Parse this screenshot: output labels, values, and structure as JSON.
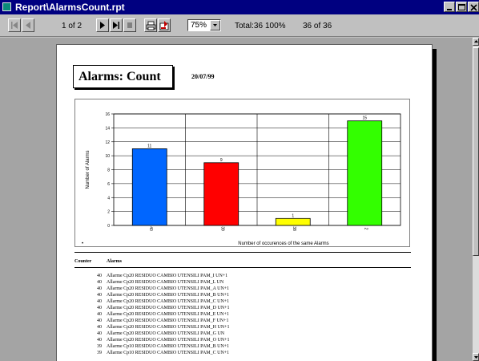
{
  "window": {
    "title": "Report\\AlarmsCount.rpt"
  },
  "toolbar": {
    "page_label": "1 of 2",
    "zoom": "75%",
    "total": "Total:36",
    "percent": "100%",
    "records": "36 of 36"
  },
  "report": {
    "title": "Alarms: Count",
    "date": "20/07/99",
    "columns": {
      "counter": "Counter",
      "alarms": "Alarms"
    },
    "rows": [
      {
        "counter": "40",
        "text": "Allarme Cp20 RESIDUO CAMBIO UTENSILI PAM_I UN+1"
      },
      {
        "counter": "40",
        "text": "Allarme Cp20 RESIDUO CAMBIO UTENSILI PAM_L UN"
      },
      {
        "counter": "40",
        "text": "Allarme Cp20 RESIDUO CAMBIO UTENSILI PAM_A UN+1"
      },
      {
        "counter": "40",
        "text": "Allarme Cp20 RESIDUO CAMBIO UTENSILI PAM_B UN+1"
      },
      {
        "counter": "40",
        "text": "Allarme Cp20 RESIDUO CAMBIO UTENSILI PAM_C UN+1"
      },
      {
        "counter": "40",
        "text": "Allarme Cp20 RESIDUO CAMBIO UTENSILI PAM_D UN+1"
      },
      {
        "counter": "40",
        "text": "Allarme Cp20 RESIDUO CAMBIO UTENSILI PAM_E UN+1"
      },
      {
        "counter": "40",
        "text": "Allarme Cp20 RESIDUO CAMBIO UTENSILI PAM_F UN+1"
      },
      {
        "counter": "40",
        "text": "Allarme Cp20 RESIDUO CAMBIO UTENSILI PAM_H UN+1"
      },
      {
        "counter": "40",
        "text": "Allarme Cp20 RESIDUO CAMBIO UTENSILI PAM_G UN"
      },
      {
        "counter": "40",
        "text": "Allarme Cp20 RESIDUO CAMBIO UTENSILI PAM_O UN+1"
      },
      {
        "counter": "39",
        "text": "Allarme Cp10 RESIDUO CAMBIO UTENSILI PAM_B UN+1"
      },
      {
        "counter": "39",
        "text": "Allarme Cp10 RESIDUO CAMBIO UTENSILI PAM_C UN+1"
      }
    ]
  },
  "chart_data": {
    "type": "bar",
    "title": "",
    "xlabel": "Number of occurences of the same Alarms",
    "ylabel": "Number of Alarms",
    "ylim": [
      0,
      16
    ],
    "yticks": [
      0,
      2,
      4,
      6,
      8,
      10,
      12,
      14,
      16
    ],
    "categories": [
      "40",
      "39",
      "38",
      "2"
    ],
    "values": [
      11,
      9,
      1,
      15
    ],
    "colors": [
      "#0066ff",
      "#ff0000",
      "#ffff00",
      "#33ff00"
    ],
    "grid": true,
    "legend_marker": "•"
  },
  "colors": {
    "titlebar": "#000080",
    "viewer_bg": "#a4a4a4"
  }
}
